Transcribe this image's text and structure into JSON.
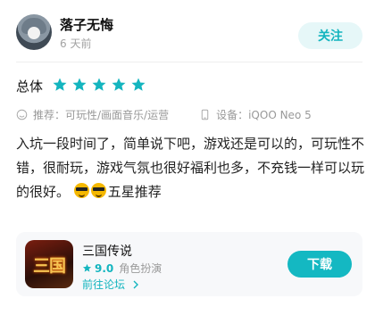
{
  "header": {
    "username": "落子无悔",
    "time": "6 天前",
    "follow_label": "关注"
  },
  "rating": {
    "label": "总体",
    "stars": 5,
    "star_color": "#14b5bf"
  },
  "meta": {
    "recommend_icon": "smile-icon",
    "recommend": "推荐：可玩性/画面音乐/运营",
    "device_icon": "phone-icon",
    "device": "设备：iQOO Neo 5"
  },
  "review": {
    "text": "入坑一段时间了，简单说下吧，游戏还是可以的，可玩性不错，很耐玩，游戏气氛也很好福利也多，不充钱一样可以玩的很好。",
    "emoji": "cool-face-emoji",
    "suffix": "五星推荐"
  },
  "app": {
    "icon_text": "三国",
    "name": "三国传说",
    "rating": "9.0",
    "genre": "角色扮演",
    "forum_link": "前往论坛",
    "download_label": "下载",
    "accent_color": "#14b8c2"
  }
}
